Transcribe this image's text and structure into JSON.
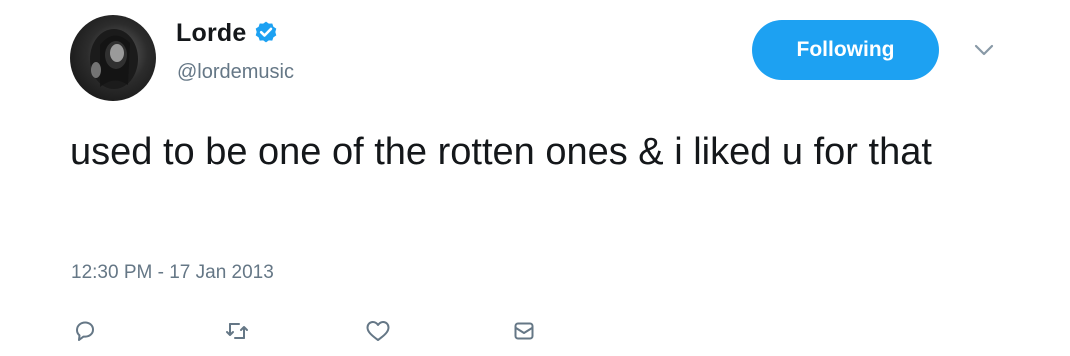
{
  "user": {
    "display_name": "Lorde",
    "handle": "@lordemusic",
    "avatar_icon": "user-avatar-photo",
    "verified_icon": "verified-badge-icon"
  },
  "follow_button": {
    "label": "Following"
  },
  "menu": {
    "icon": "chevron-down-icon"
  },
  "tweet": {
    "text": "used to be one of the rotten ones & i liked u for that",
    "timestamp": "12:30 PM - 17 Jan 2013"
  },
  "actions": [
    {
      "name": "reply",
      "icon": "reply-icon"
    },
    {
      "name": "retweet",
      "icon": "retweet-icon"
    },
    {
      "name": "like",
      "icon": "heart-icon"
    },
    {
      "name": "direct-message",
      "icon": "envelope-icon"
    }
  ],
  "colors": {
    "accent": "#1da1f2",
    "text": "#14171a",
    "secondary": "#657786"
  }
}
